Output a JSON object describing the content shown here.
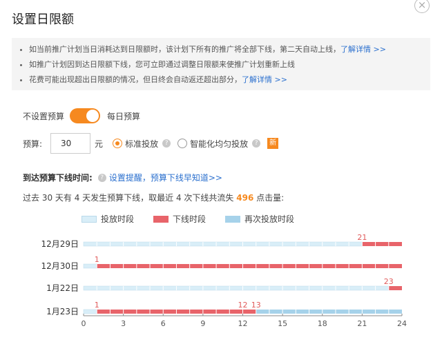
{
  "dialog": {
    "title": "设置日限额",
    "close": "×"
  },
  "notice": {
    "items": [
      {
        "text": "如当前推广计划当日消耗达到日限额时，该计划下所有的推广将全部下线，第二天自动上线，",
        "link": "了解详情 >>"
      },
      {
        "text": "如推广计划因到达日限额下线，您可立即通过调整日限额来使推广计划重新上线",
        "link": ""
      },
      {
        "text": "花费可能出现超出日限额的情况，但日终会自动返还超出部分，",
        "link": "了解详情 >>"
      }
    ]
  },
  "budget_mode": {
    "left_label": "不设置预算",
    "right_label": "每日预算",
    "enabled": true
  },
  "budget": {
    "label": "预算:",
    "value": "30",
    "unit": "元",
    "option_standard": "标准投放",
    "option_smart": "智能化均匀投放",
    "new_badge": "新",
    "help_icon": "?"
  },
  "offline_time": {
    "label": "到达预算下线时间:",
    "link": "设置提醒，预算下线早知道>>"
  },
  "summary": {
    "prefix": "过去 30 天有 4 天发生预算下线，取最近 4 次下线共流失 ",
    "lost": "496",
    "suffix": " 点击量:"
  },
  "legend": {
    "online": "投放时段",
    "offline": "下线时段",
    "reonline": "再次投放时段"
  },
  "colors": {
    "accent": "#f6891f",
    "online": "#d9eef8",
    "offline": "#e8646a",
    "reonline": "#a6d2ea",
    "link": "#2a6fce"
  },
  "chart_data": {
    "type": "bar",
    "orientation": "horizontal-timeline",
    "x_ticks": [
      0,
      3,
      6,
      9,
      12,
      15,
      18,
      21,
      24
    ],
    "xlim": [
      0,
      24
    ],
    "rows": [
      {
        "day": "12月29日",
        "segments": [
          {
            "from": 0,
            "to": 21,
            "kind": "online"
          },
          {
            "from": 21,
            "to": 24,
            "kind": "offline"
          }
        ],
        "labels": [
          {
            "at": 21,
            "text": "21"
          }
        ]
      },
      {
        "day": "12月30日",
        "segments": [
          {
            "from": 0,
            "to": 1,
            "kind": "online"
          },
          {
            "from": 1,
            "to": 24,
            "kind": "offline"
          }
        ],
        "labels": [
          {
            "at": 1,
            "text": "1"
          }
        ]
      },
      {
        "day": "1月22日",
        "segments": [
          {
            "from": 0,
            "to": 23,
            "kind": "online"
          },
          {
            "from": 23,
            "to": 24,
            "kind": "offline"
          }
        ],
        "labels": [
          {
            "at": 23,
            "text": "23"
          }
        ]
      },
      {
        "day": "1月23日",
        "segments": [
          {
            "from": 0,
            "to": 1,
            "kind": "online"
          },
          {
            "from": 1,
            "to": 12,
            "kind": "offline"
          },
          {
            "from": 12,
            "to": 13,
            "kind": "offline"
          },
          {
            "from": 13,
            "to": 24,
            "kind": "reonline"
          }
        ],
        "labels": [
          {
            "at": 1,
            "text": "1"
          },
          {
            "at": 12,
            "text": "12"
          },
          {
            "at": 13,
            "text": "13"
          }
        ]
      }
    ]
  }
}
